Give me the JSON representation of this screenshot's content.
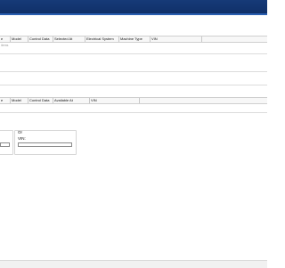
{
  "top_grid": {
    "columns": [
      "e",
      "Model",
      "Control Data",
      "Selected At",
      "Electrical System",
      "Machine Type",
      "VIN"
    ],
    "hint": "items"
  },
  "bottom_grid": {
    "columns": [
      "e",
      "Model",
      "Control Data",
      "Available At",
      "VIN"
    ]
  },
  "search": {
    "or_label": "Or",
    "vin_label": "VIN:",
    "left_input_value": "",
    "vin_input_value": ""
  },
  "colors": {
    "titlebar": "#163a78",
    "accent": "#2a5fb0"
  }
}
